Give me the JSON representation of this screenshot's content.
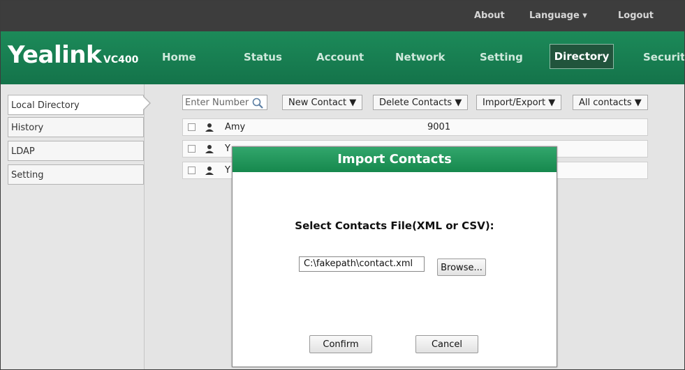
{
  "topbar": {
    "about": "About",
    "language": "Language ▾",
    "logout": "Logout"
  },
  "header": {
    "logo": "Yealink",
    "model": "VC400",
    "nav": [
      "Home",
      "Status",
      "Account",
      "Network",
      "Setting",
      "Directory",
      "Security"
    ],
    "active_nav": "Directory"
  },
  "sidebar": {
    "items": [
      {
        "label": "Local Directory"
      },
      {
        "label": "History"
      },
      {
        "label": "LDAP"
      },
      {
        "label": "Setting"
      }
    ]
  },
  "toolbar": {
    "search_placeholder": "Enter Number",
    "new_contact": "New Contact ▼",
    "delete_contacts": "Delete Contacts ▼",
    "import_export": "Import/Export ▼",
    "filter": "All contacts ▼"
  },
  "contacts": [
    {
      "name": "Amy",
      "number": "9001"
    },
    {
      "name": "Y",
      "number": ""
    },
    {
      "name": "Y",
      "number": ""
    }
  ],
  "dialog": {
    "title": "Import Contacts",
    "label": "Select Contacts File(XML or CSV):",
    "file_value": "C:\\fakepath\\contact.xml",
    "browse": "Browse...",
    "confirm": "Confirm",
    "cancel": "Cancel"
  }
}
